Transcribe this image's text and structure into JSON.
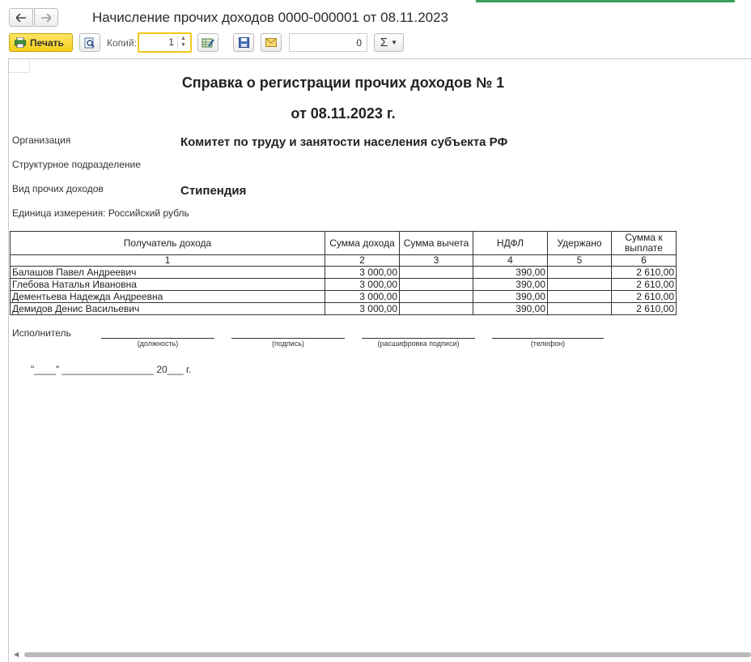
{
  "window": {
    "title": "Начисление прочих доходов 0000-000001 от 08.11.2023"
  },
  "toolbar": {
    "print_label": "Печать",
    "copies_label": "Копий:",
    "copies_value": "1",
    "sum_value": "0",
    "sigma_label": "Σ"
  },
  "document": {
    "title_line1": "Справка о регистрации прочих доходов № 1",
    "title_line2": "от 08.11.2023 г.",
    "organization_label": "Организация",
    "organization_value": "Комитет по труду и занятости населения субъекта РФ",
    "department_label": "Структурное подразделение",
    "income_type_label": "Вид прочих доходов",
    "income_type_value": "Стипендия",
    "unit_label": "Единица измерения: Российский рубль",
    "table": {
      "headers": [
        "Получатель дохода",
        "Сумма дохода",
        "Сумма вычета",
        "НДФЛ",
        "Удержано",
        "Сумма к выплате"
      ],
      "column_numbers": [
        "1",
        "2",
        "3",
        "4",
        "5",
        "6"
      ],
      "rows": [
        [
          "Балашов Павел Андреевич",
          "3 000,00",
          "",
          "390,00",
          "",
          "2 610,00"
        ],
        [
          "Глебова Наталья Ивановна",
          "3 000,00",
          "",
          "390,00",
          "",
          "2 610,00"
        ],
        [
          "Дементьева Надежда Андреевна",
          "3 000,00",
          "",
          "390,00",
          "",
          "2 610,00"
        ],
        [
          "Демидов Денис Васильевич",
          "3 000,00",
          "",
          "390,00",
          "",
          "2 610,00"
        ]
      ]
    },
    "executor_label": "Исполнитель",
    "signature_captions": [
      "(должность)",
      "(подпись)",
      "(расшифровка подписи)",
      "(телефон)"
    ],
    "date_line": "\"____\" _________________ 20___ г."
  },
  "colors": {
    "print_button": "#f5cf1a",
    "copies_border": "#f2c618",
    "accent_top": "#3aa05a"
  }
}
